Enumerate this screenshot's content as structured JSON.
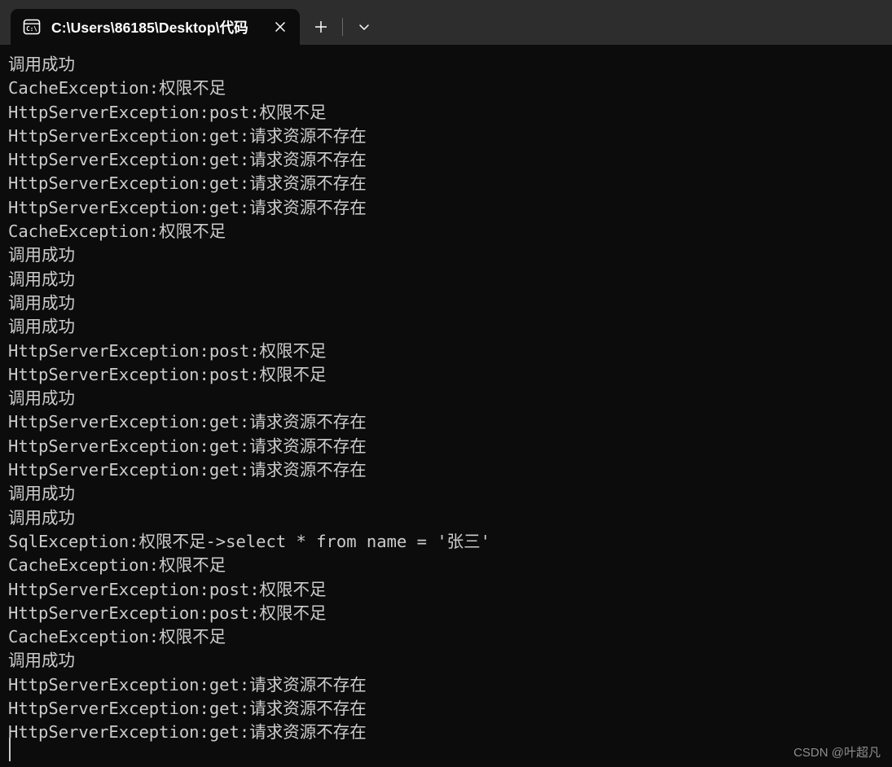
{
  "window": {
    "app": "Windows Terminal",
    "titlebar_color": "#2d2d2d",
    "terminal_bg": "#0c0c0c",
    "terminal_fg": "#cccccc"
  },
  "tabbar": {
    "tabs": [
      {
        "icon": "command-prompt-icon",
        "icon_text": "C:\\",
        "title": "C:\\Users\\86185\\Desktop\\代码",
        "active": true,
        "close_label": "✕"
      }
    ],
    "new_tab_label": "+",
    "dropdown_label": "⌄"
  },
  "terminal": {
    "lines": [
      "调用成功",
      "CacheException:权限不足",
      "HttpServerException:post:权限不足",
      "HttpServerException:get:请求资源不存在",
      "HttpServerException:get:请求资源不存在",
      "HttpServerException:get:请求资源不存在",
      "HttpServerException:get:请求资源不存在",
      "CacheException:权限不足",
      "调用成功",
      "调用成功",
      "调用成功",
      "调用成功",
      "HttpServerException:post:权限不足",
      "HttpServerException:post:权限不足",
      "调用成功",
      "HttpServerException:get:请求资源不存在",
      "HttpServerException:get:请求资源不存在",
      "HttpServerException:get:请求资源不存在",
      "调用成功",
      "调用成功",
      "SqlException:权限不足->select * from name = '张三'",
      "CacheException:权限不足",
      "HttpServerException:post:权限不足",
      "HttpServerException:post:权限不足",
      "CacheException:权限不足",
      "调用成功",
      "HttpServerException:get:请求资源不存在",
      "HttpServerException:get:请求资源不存在",
      "HttpServerException:get:请求资源不存在"
    ],
    "cursor_visible": true
  },
  "watermark": {
    "text": "CSDN @叶超凡"
  }
}
